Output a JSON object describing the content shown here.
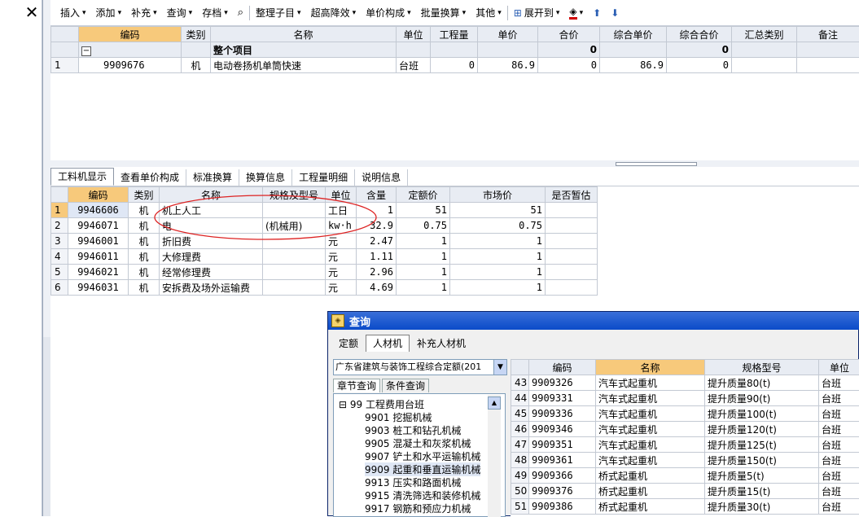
{
  "toolbar": {
    "close": "✕",
    "items": [
      "插入",
      "添加",
      "补充",
      "查询",
      "存档",
      "整理子目",
      "超高降效",
      "单价构成",
      "批量换算",
      "其他",
      "展开到"
    ]
  },
  "top_grid": {
    "headers": [
      "编码",
      "类别",
      "名称",
      "单位",
      "工程量",
      "单价",
      "合价",
      "综合单价",
      "综合合价",
      "汇总类别",
      "备注"
    ],
    "group_row": {
      "name": "整个项目",
      "total": "0",
      "comp_total": "0",
      "toggle": "−"
    },
    "rows": [
      {
        "rn": "1",
        "code": "9909676",
        "type": "机",
        "name": "电动卷扬机单筒快速",
        "unit": "台班",
        "qty": "0",
        "price": "86.9",
        "amount": "0",
        "comp_price": "86.9",
        "comp_amount": "0"
      }
    ]
  },
  "tabs": [
    "工料机显示",
    "查看单价构成",
    "标准换算",
    "换算信息",
    "工程量明细",
    "说明信息"
  ],
  "bottom_grid": {
    "headers": [
      "编码",
      "类别",
      "名称",
      "规格及型号",
      "单位",
      "含量",
      "定额价",
      "市场价",
      "是否暂估"
    ],
    "rows": [
      {
        "rn": "1",
        "code": "9946606",
        "type": "机",
        "name": "机上人工",
        "spec": "",
        "unit": "工日",
        "qty": "1",
        "quota": "51",
        "market": "51"
      },
      {
        "rn": "2",
        "code": "9946071",
        "type": "机",
        "name": "电",
        "spec": "(机械用)",
        "unit": "kw·h",
        "qty": "32.9",
        "quota": "0.75",
        "market": "0.75"
      },
      {
        "rn": "3",
        "code": "9946001",
        "type": "机",
        "name": "折旧费",
        "spec": "",
        "unit": "元",
        "qty": "2.47",
        "quota": "1",
        "market": "1"
      },
      {
        "rn": "4",
        "code": "9946011",
        "type": "机",
        "name": "大修理费",
        "spec": "",
        "unit": "元",
        "qty": "1.11",
        "quota": "1",
        "market": "1"
      },
      {
        "rn": "5",
        "code": "9946021",
        "type": "机",
        "name": "经常修理费",
        "spec": "",
        "unit": "元",
        "qty": "2.96",
        "quota": "1",
        "market": "1"
      },
      {
        "rn": "6",
        "code": "9946031",
        "type": "机",
        "name": "安拆费及场外运输费",
        "spec": "",
        "unit": "元",
        "qty": "4.69",
        "quota": "1",
        "market": "1"
      }
    ]
  },
  "dialog": {
    "title": "查询",
    "tabs": [
      "定额",
      "人材机",
      "补充人材机"
    ],
    "select_value": "广东省建筑与装饰工程综合定额(201",
    "subtabs": [
      "章节查询",
      "条件查询"
    ],
    "tree": [
      {
        "label": "99 工程费用台班",
        "level": 0,
        "toggle": "⊟"
      },
      {
        "label": "9901 挖掘机械",
        "level": 1
      },
      {
        "label": "9903 桩工和钻孔机械",
        "level": 1
      },
      {
        "label": "9905 混凝土和灰浆机械",
        "level": 1
      },
      {
        "label": "9907 铲土和水平运输机械",
        "level": 1
      },
      {
        "label": "9909 起重和垂直运输机械",
        "level": 1,
        "selected": true
      },
      {
        "label": "9913 压实和路面机械",
        "level": 1
      },
      {
        "label": "9915 清洗筛选和装修机械",
        "level": 1
      },
      {
        "label": "9917 钢筋和预应力机械",
        "level": 1
      }
    ],
    "grid_headers": [
      "编码",
      "名称",
      "规格型号",
      "单位"
    ],
    "grid_rows": [
      {
        "rn": "43",
        "code": "9909326",
        "name": "汽车式起重机",
        "spec": "提升质量80(t)",
        "unit": "台班"
      },
      {
        "rn": "44",
        "code": "9909331",
        "name": "汽车式起重机",
        "spec": "提升质量90(t)",
        "unit": "台班"
      },
      {
        "rn": "45",
        "code": "9909336",
        "name": "汽车式起重机",
        "spec": "提升质量100(t)",
        "unit": "台班"
      },
      {
        "rn": "46",
        "code": "9909346",
        "name": "汽车式起重机",
        "spec": "提升质量120(t)",
        "unit": "台班"
      },
      {
        "rn": "47",
        "code": "9909351",
        "name": "汽车式起重机",
        "spec": "提升质量125(t)",
        "unit": "台班"
      },
      {
        "rn": "48",
        "code": "9909361",
        "name": "汽车式起重机",
        "spec": "提升质量150(t)",
        "unit": "台班"
      },
      {
        "rn": "49",
        "code": "9909366",
        "name": "桥式起重机",
        "spec": "提升质量5(t)",
        "unit": "台班"
      },
      {
        "rn": "50",
        "code": "9909376",
        "name": "桥式起重机",
        "spec": "提升质量15(t)",
        "unit": "台班"
      },
      {
        "rn": "51",
        "code": "9909386",
        "name": "桥式起重机",
        "spec": "提升质量30(t)",
        "unit": "台班"
      }
    ]
  }
}
